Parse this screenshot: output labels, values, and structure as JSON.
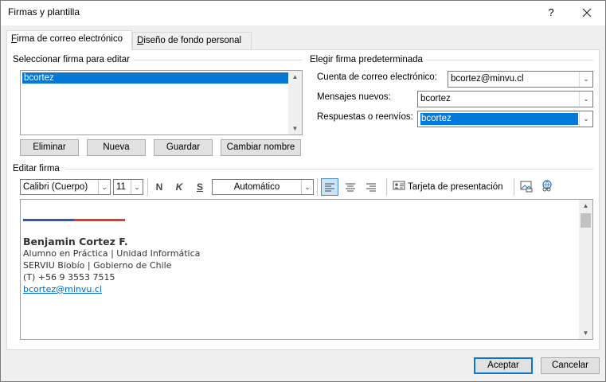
{
  "window": {
    "title": "Firmas y plantilla",
    "help_label": "?"
  },
  "tabs": [
    {
      "label": "Firma de correo electrónico",
      "accel": "F",
      "rest": "irma de correo electrónico"
    },
    {
      "label": "Diseño de fondo personal",
      "accel": "D",
      "rest": "iseño de fondo personal"
    }
  ],
  "select_signature": {
    "group_label": "Seleccionar firma para editar",
    "items": [
      "bcortez"
    ],
    "selected": "bcortez",
    "buttons": [
      "Eliminar",
      "Nueva",
      "Guardar",
      "Cambiar nombre"
    ]
  },
  "default_signature": {
    "group_label": "Elegir firma predeterminada",
    "account_label": "Cuenta de correo electrónico:",
    "account_value": "bcortez@minvu.cl",
    "new_messages_label": "Mensajes nuevos:",
    "new_messages_value": "bcortez",
    "replies_label": "Respuestas o reenvíos:",
    "replies_value": "bcortez"
  },
  "editor": {
    "group_label": "Editar firma",
    "font_name": "Calibri (Cuerpo)",
    "font_size": "11",
    "bold_label": "N",
    "italic_label": "K",
    "underline_label": "S",
    "color_label": "Automático",
    "business_card_label": "Tarjeta de presentación",
    "accent_colors": {
      "blue": "#1f5fa8",
      "red": "#e03a3e"
    },
    "signature": {
      "name": "Benjamin Cortez F.",
      "line1": "Alumno en Práctica | Unidad Informática",
      "line2": "SERVIU Biobío | Gobierno de Chile",
      "line3": "(T) +56 9 3553 7515",
      "email": "bcortez@minvu.cl"
    }
  },
  "footer": {
    "ok_label": "Aceptar",
    "cancel_label": "Cancelar"
  }
}
